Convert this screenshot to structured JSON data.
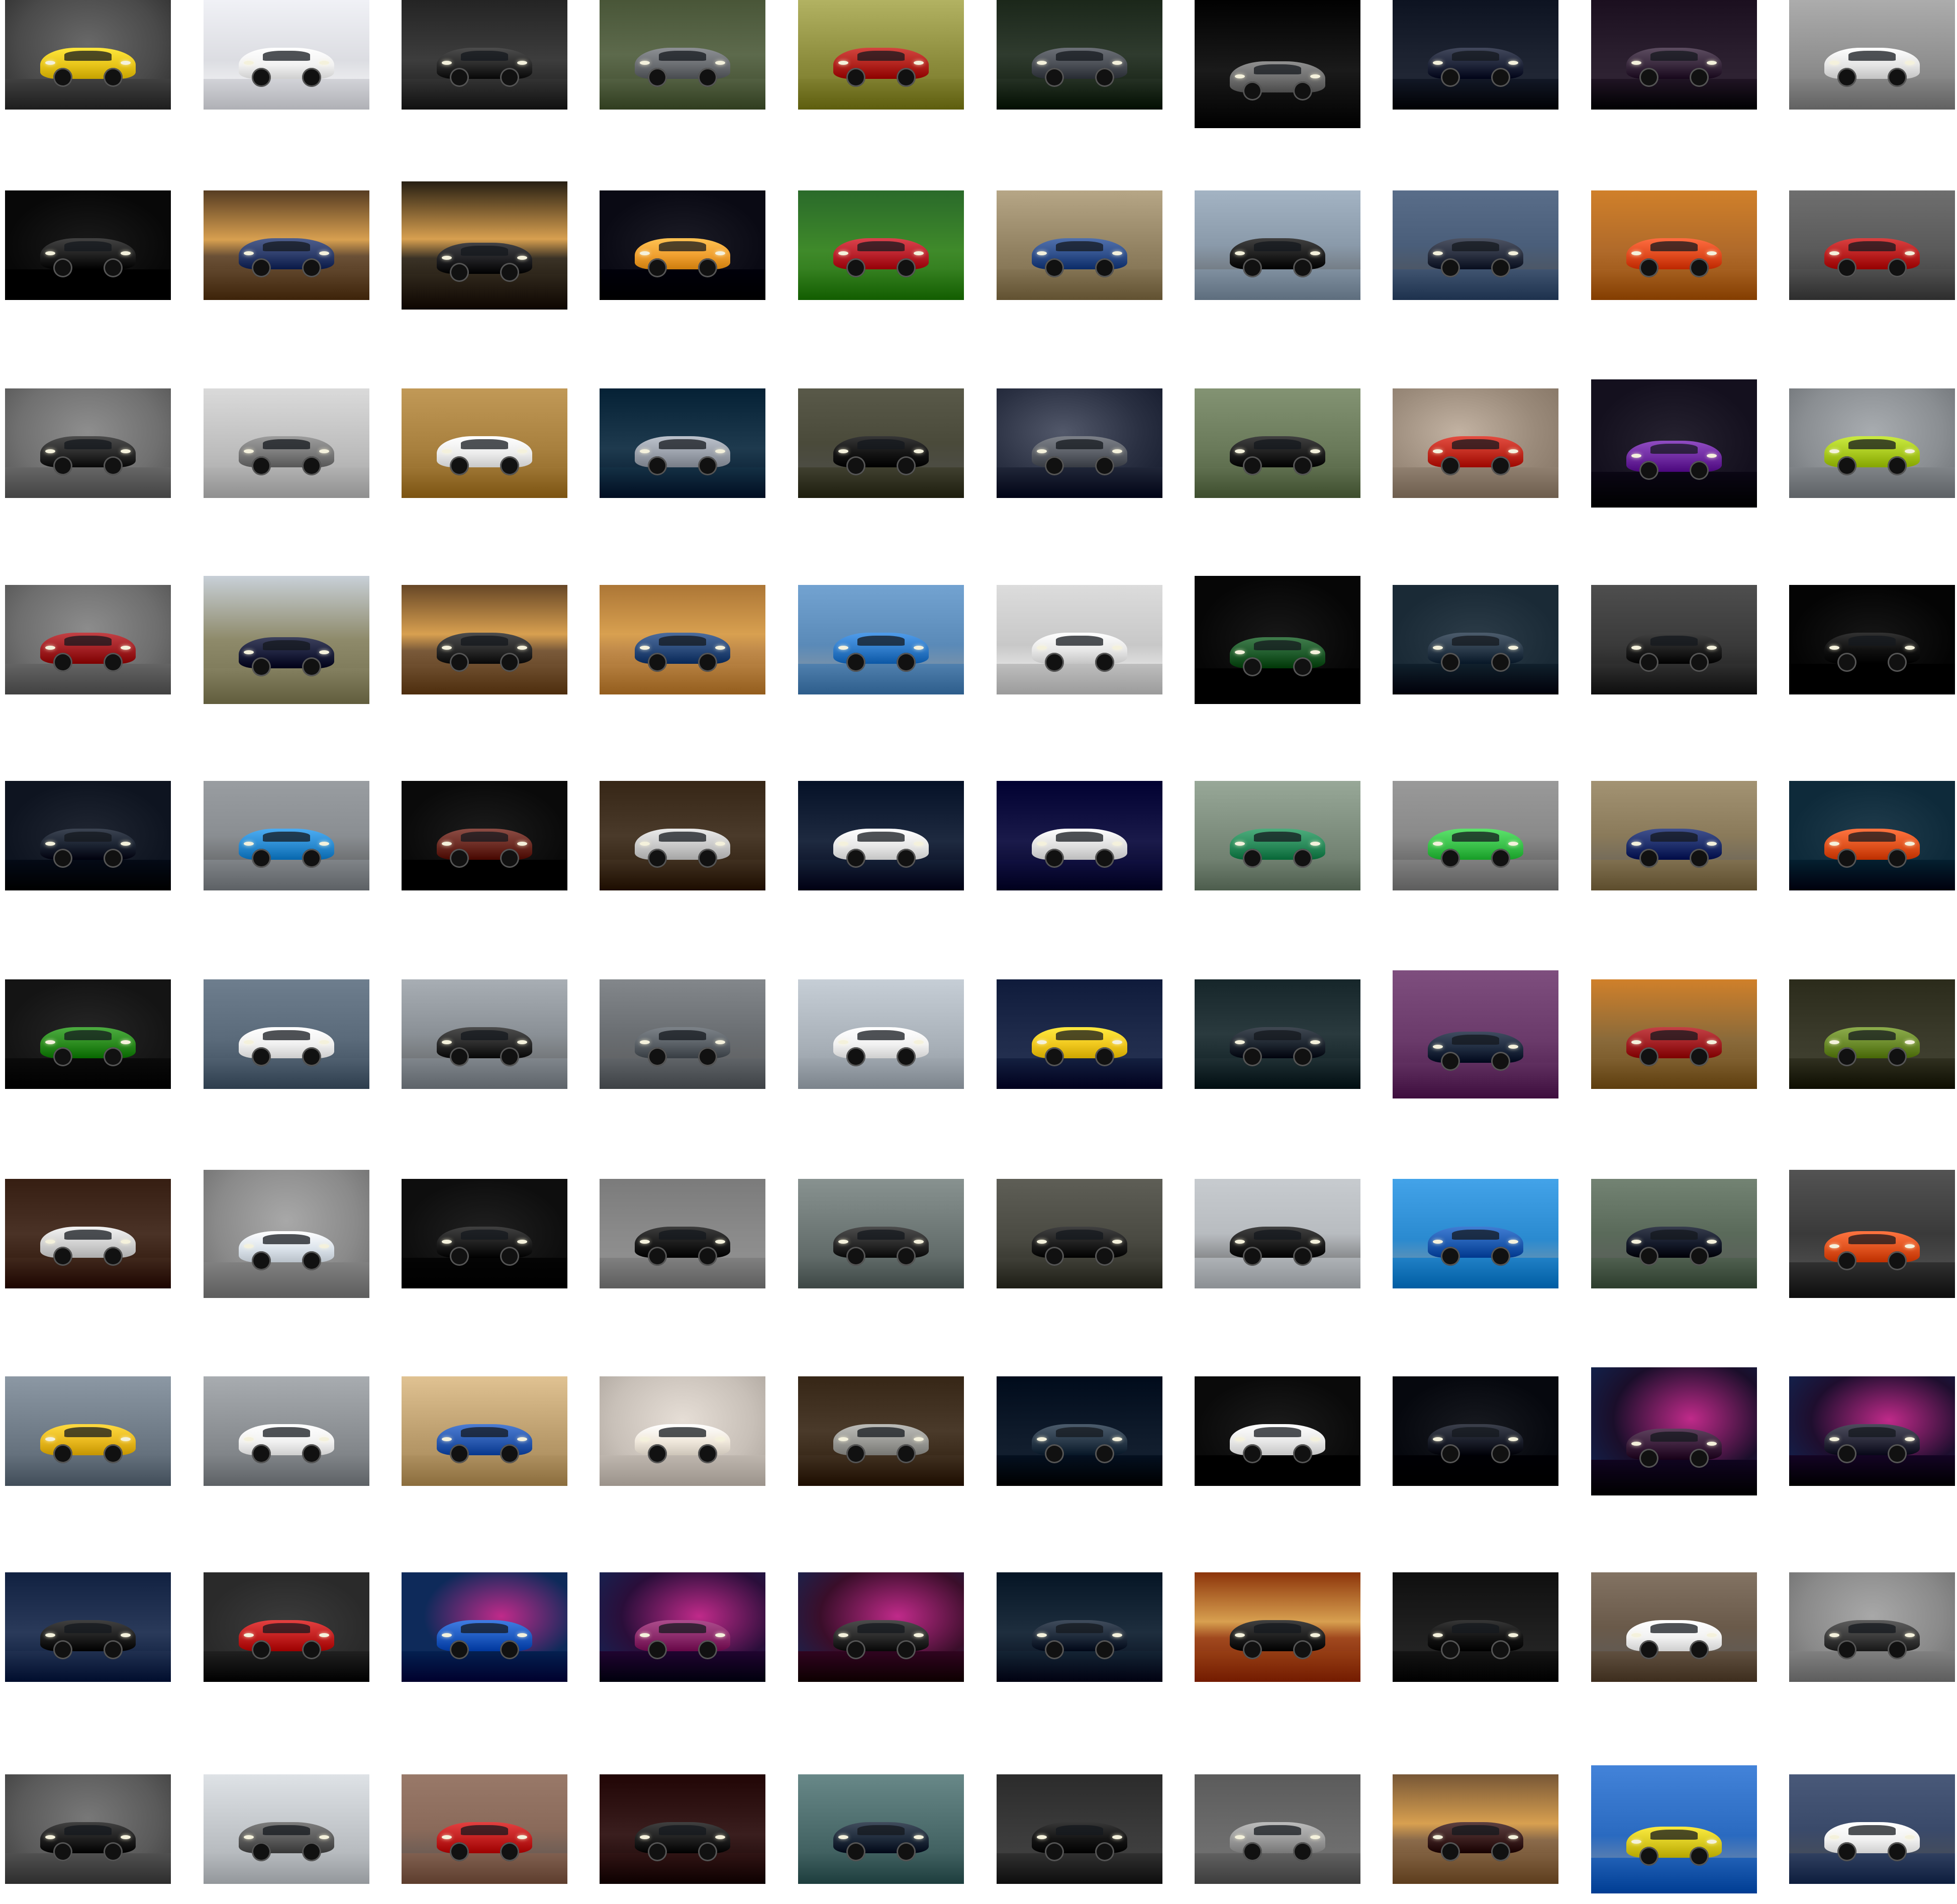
{
  "gallery": {
    "columns": 10,
    "rows": 10,
    "background": "#ffffff",
    "tiles": [
      {
        "scene": "studio",
        "car": "#e8c51a",
        "bg": "#4a4a4a",
        "aspect": "wide"
      },
      {
        "scene": "snow",
        "car": "#f2f2f2",
        "bg": "#dcdde2",
        "aspect": "wide"
      },
      {
        "scene": "night",
        "car": "#2a2a2a",
        "bg": "#3d3d3d",
        "aspect": "wide"
      },
      {
        "scene": "forest",
        "car": "#6b6e72",
        "bg": "#5d6a4c",
        "aspect": "wide"
      },
      {
        "scene": "sunny",
        "car": "#b0221c",
        "bg": "#8a8a3a",
        "aspect": "wide"
      },
      {
        "scene": "forest",
        "car": "#4a4e55",
        "bg": "#2f3b2e",
        "aspect": "wide"
      },
      {
        "scene": "night",
        "car": "#6e6e6e",
        "bg": "#1a1a1a",
        "aspect": "tall"
      },
      {
        "scene": "garage",
        "car": "#20263a",
        "bg": "#1c2230",
        "aspect": "wide"
      },
      {
        "scene": "garage",
        "car": "#3a2a3e",
        "bg": "#2a1e2e",
        "aspect": "wide"
      },
      {
        "scene": "hangar",
        "car": "#e6e6e6",
        "bg": "#8e8e8e",
        "aspect": "wide"
      },
      {
        "scene": "dark",
        "car": "#202020",
        "bg": "#080808",
        "aspect": "wide"
      },
      {
        "scene": "sunset",
        "car": "#2c3c6a",
        "bg": "#6a5036",
        "aspect": "wide"
      },
      {
        "scene": "sunset",
        "car": "#1f1f22",
        "bg": "#3a3226",
        "aspect": "tall"
      },
      {
        "scene": "dark",
        "car": "#f0a030",
        "bg": "#0a0a14",
        "aspect": "wide"
      },
      {
        "scene": "grass",
        "car": "#b8202a",
        "bg": "#3f8a2a",
        "aspect": "wide"
      },
      {
        "scene": "sunny",
        "car": "#2e4e8a",
        "bg": "#8e7e5e",
        "aspect": "wide"
      },
      {
        "scene": "road",
        "car": "#1e1e1e",
        "bg": "#8a9aaa",
        "aspect": "wide"
      },
      {
        "scene": "street",
        "car": "#2a3040",
        "bg": "#4a5e7a",
        "aspect": "wide"
      },
      {
        "scene": "autumn",
        "car": "#e04a1e",
        "bg": "#b06a2a",
        "aspect": "wide"
      },
      {
        "scene": "dusk",
        "car": "#b81e1e",
        "bg": "#5a5a5a",
        "aspect": "wide"
      },
      {
        "scene": "studio",
        "car": "#2a2a2a",
        "bg": "#707070",
        "aspect": "wide"
      },
      {
        "scene": "hangar",
        "car": "#7a7a7a",
        "bg": "#bcbcbc",
        "aspect": "wide"
      },
      {
        "scene": "field",
        "car": "#ececec",
        "bg": "#a8803e",
        "aspect": "wide"
      },
      {
        "scene": "night",
        "car": "#9aa0aa",
        "bg": "#1e3a4e",
        "aspect": "wide"
      },
      {
        "scene": "street",
        "car": "#141414",
        "bg": "#4a4a3a",
        "aspect": "wide"
      },
      {
        "scene": "smoke",
        "car": "#5a5e66",
        "bg": "#2a3042",
        "aspect": "wide"
      },
      {
        "scene": "field",
        "car": "#1e1e1e",
        "bg": "#6a7a5a",
        "aspect": "wide"
      },
      {
        "scene": "smoke",
        "car": "#c02a1e",
        "bg": "#9a8a7a",
        "aspect": "wide"
      },
      {
        "scene": "dark",
        "car": "#6e2aa0",
        "bg": "#14101e",
        "aspect": "tall"
      },
      {
        "scene": "studio",
        "car": "#a8c81e",
        "bg": "#8a8e92",
        "aspect": "wide"
      },
      {
        "scene": "studio",
        "car": "#a01e22",
        "bg": "#6e6e6e",
        "aspect": "wide"
      },
      {
        "scene": "villa",
        "car": "#1a1e3a",
        "bg": "#8e8a6a",
        "aspect": "tall"
      },
      {
        "scene": "sunset",
        "car": "#2a2a2a",
        "bg": "#7a5a3a",
        "aspect": "wide"
      },
      {
        "scene": "sunset",
        "car": "#2a4a7a",
        "bg": "#c08a4a",
        "aspect": "wide"
      },
      {
        "scene": "sky",
        "car": "#2e7ac8",
        "bg": "#5a8ab8",
        "aspect": "wide"
      },
      {
        "scene": "snow",
        "car": "#e8e8e8",
        "bg": "#c8c8c8",
        "aspect": "wide"
      },
      {
        "scene": "dark",
        "car": "#1e5a2a",
        "bg": "#060606",
        "aspect": "tall"
      },
      {
        "scene": "dark",
        "car": "#2a3a4a",
        "bg": "#1a2a36",
        "aspect": "wide"
      },
      {
        "scene": "dusk",
        "car": "#1e1e1e",
        "bg": "#3a3a3a",
        "aspect": "wide"
      },
      {
        "scene": "dark",
        "car": "#101010",
        "bg": "#040404",
        "aspect": "wide"
      },
      {
        "scene": "dark",
        "car": "#1a2230",
        "bg": "#0e1420",
        "aspect": "wide"
      },
      {
        "scene": "street",
        "car": "#2a8ad0",
        "bg": "#8a8e92",
        "aspect": "wide"
      },
      {
        "scene": "dark",
        "car": "#6a2a22",
        "bg": "#0a0a0a",
        "aspect": "wide"
      },
      {
        "scene": "forest",
        "car": "#c8c8c8",
        "bg": "#4a3a2a",
        "aspect": "wide"
      },
      {
        "scene": "night",
        "car": "#e8e8e8",
        "bg": "#1e2a40",
        "aspect": "wide"
      },
      {
        "scene": "night",
        "car": "#e0e0e0",
        "bg": "#1a1a4a",
        "aspect": "wide"
      },
      {
        "scene": "cloudy",
        "car": "#2a8a5a",
        "bg": "#7a8a7a",
        "aspect": "wide"
      },
      {
        "scene": "street",
        "car": "#3ac04a",
        "bg": "#8a8a8a",
        "aspect": "wide"
      },
      {
        "scene": "road",
        "car": "#1e2e6a",
        "bg": "#8a7a5a",
        "aspect": "wide"
      },
      {
        "scene": "dark",
        "car": "#e0521e",
        "bg": "#0e2a3a",
        "aspect": "wide"
      },
      {
        "scene": "dark",
        "car": "#2a8a1e",
        "bg": "#141414",
        "aspect": "wide"
      },
      {
        "scene": "dusk",
        "car": "#f0f0f0",
        "bg": "#5a6a7a",
        "aspect": "wide"
      },
      {
        "scene": "city",
        "car": "#2a2a2a",
        "bg": "#8a9096",
        "aspect": "wide"
      },
      {
        "scene": "road",
        "car": "#5a6066",
        "bg": "#6a6e72",
        "aspect": "wide"
      },
      {
        "scene": "hangar",
        "car": "#f2f2f2",
        "bg": "#a8b0b8",
        "aspect": "wide"
      },
      {
        "scene": "garage",
        "car": "#f0c81e",
        "bg": "#1e2a4a",
        "aspect": "wide"
      },
      {
        "scene": "forest",
        "car": "#1e2630",
        "bg": "#2a3a3e",
        "aspect": "wide"
      },
      {
        "scene": "dusk",
        "car": "#1e2a3e",
        "bg": "#6a3a6a",
        "aspect": "tall"
      },
      {
        "scene": "autumn",
        "car": "#a01e22",
        "bg": "#8a6a3a",
        "aspect": "wide"
      },
      {
        "scene": "garage",
        "car": "#6a8a2a",
        "bg": "#3a3a2a",
        "aspect": "wide"
      },
      {
        "scene": "forest",
        "car": "#d0d0d0",
        "bg": "#4a3226",
        "aspect": "wide"
      },
      {
        "scene": "studio",
        "car": "#dce4ec",
        "bg": "#8a8a8a",
        "aspect": "tall"
      },
      {
        "scene": "dark",
        "car": "#1e1e1e",
        "bg": "#0e0e0e",
        "aspect": "wide"
      },
      {
        "scene": "garage",
        "car": "#1a1a1a",
        "bg": "#8a8a8a",
        "aspect": "wide"
      },
      {
        "scene": "cloudy",
        "car": "#2a2a2a",
        "bg": "#6a7472",
        "aspect": "wide"
      },
      {
        "scene": "dusk",
        "car": "#1e1e1e",
        "bg": "#4a4a42",
        "aspect": "wide"
      },
      {
        "scene": "street",
        "car": "#1e1e1e",
        "bg": "#b8bcc0",
        "aspect": "wide"
      },
      {
        "scene": "sky",
        "car": "#1e5ab0",
        "bg": "#2a8ad0",
        "aspect": "wide"
      },
      {
        "scene": "road",
        "car": "#141a2a",
        "bg": "#5a6a5a",
        "aspect": "wide"
      },
      {
        "scene": "road",
        "car": "#e0521e",
        "bg": "#3a3a3a",
        "aspect": "tall"
      },
      {
        "scene": "cloudy",
        "car": "#e8b81e",
        "bg": "#6e7a86",
        "aspect": "wide"
      },
      {
        "scene": "cloudy",
        "car": "#f2f2f2",
        "bg": "#8a8e92",
        "aspect": "wide"
      },
      {
        "scene": "sunny",
        "car": "#2a5ab0",
        "bg": "#b89a6a",
        "aspect": "wide"
      },
      {
        "scene": "studio",
        "car": "#f0e8dc",
        "bg": "#c8c0b8",
        "aspect": "wide"
      },
      {
        "scene": "forest",
        "car": "#9a9a96",
        "bg": "#4a3a2a",
        "aspect": "wide"
      },
      {
        "scene": "garage",
        "car": "#2a3a4a",
        "bg": "#0e1a2a",
        "aspect": "wide"
      },
      {
        "scene": "dark",
        "car": "#e8e8e8",
        "bg": "#0a0a0a",
        "aspect": "wide"
      },
      {
        "scene": "dark",
        "car": "#1a1e2a",
        "bg": "#06080e",
        "aspect": "wide"
      },
      {
        "scene": "neon",
        "car": "#3a1e3a",
        "bg": "#1a0e2a",
        "aspect": "tall"
      },
      {
        "scene": "neon",
        "car": "#2a2a3a",
        "bg": "#1e0e2e",
        "aspect": "wide"
      },
      {
        "scene": "night",
        "car": "#1e1e1e",
        "bg": "#2a3a5a",
        "aspect": "wide"
      },
      {
        "scene": "dark",
        "car": "#c01e1e",
        "bg": "#2a2a2a",
        "aspect": "wide"
      },
      {
        "scene": "neon",
        "car": "#1e5ac0",
        "bg": "#0e2a5a",
        "aspect": "wide"
      },
      {
        "scene": "neon",
        "car": "#8a2a6a",
        "bg": "#2a0e3a",
        "aspect": "wide"
      },
      {
        "scene": "neon",
        "car": "#2a2a2a",
        "bg": "#3a0e2a",
        "aspect": "wide"
      },
      {
        "scene": "night",
        "car": "#1e2a3a",
        "bg": "#1e2e3e",
        "aspect": "wide"
      },
      {
        "scene": "sunset",
        "car": "#1e1e1e",
        "bg": "#a0481e",
        "aspect": "wide"
      },
      {
        "scene": "garage",
        "car": "#141414",
        "bg": "#1e1e1e",
        "aspect": "wide"
      },
      {
        "scene": "road",
        "car": "#f2f2f2",
        "bg": "#6a5a4a",
        "aspect": "wide"
      },
      {
        "scene": "studio",
        "car": "#3a3a3a",
        "bg": "#8a8a8a",
        "aspect": "wide"
      },
      {
        "scene": "studio",
        "car": "#1e1e1e",
        "bg": "#5a5a5a",
        "aspect": "wide"
      },
      {
        "scene": "cloudy",
        "car": "#5a5a5a",
        "bg": "#c0c4c8",
        "aspect": "wide"
      },
      {
        "scene": "street",
        "car": "#c01e1e",
        "bg": "#8a6a5a",
        "aspect": "wide"
      },
      {
        "scene": "night",
        "car": "#1e1e1e",
        "bg": "#3a1e1e",
        "aspect": "wide"
      },
      {
        "scene": "cloudy",
        "car": "#1e2a3a",
        "bg": "#4a6a6a",
        "aspect": "wide"
      },
      {
        "scene": "garage",
        "car": "#141414",
        "bg": "#3a3a3a",
        "aspect": "wide"
      },
      {
        "scene": "garage",
        "car": "#9a9a9a",
        "bg": "#6a6a6a",
        "aspect": "wide"
      },
      {
        "scene": "sunset",
        "car": "#3a1e1e",
        "bg": "#8a6a4a",
        "aspect": "wide"
      },
      {
        "scene": "sky",
        "car": "#d8c81e",
        "bg": "#2a6ac0",
        "aspect": "tall"
      },
      {
        "scene": "street",
        "car": "#f2f2f2",
        "bg": "#3a4a6a",
        "aspect": "wide"
      }
    ]
  }
}
